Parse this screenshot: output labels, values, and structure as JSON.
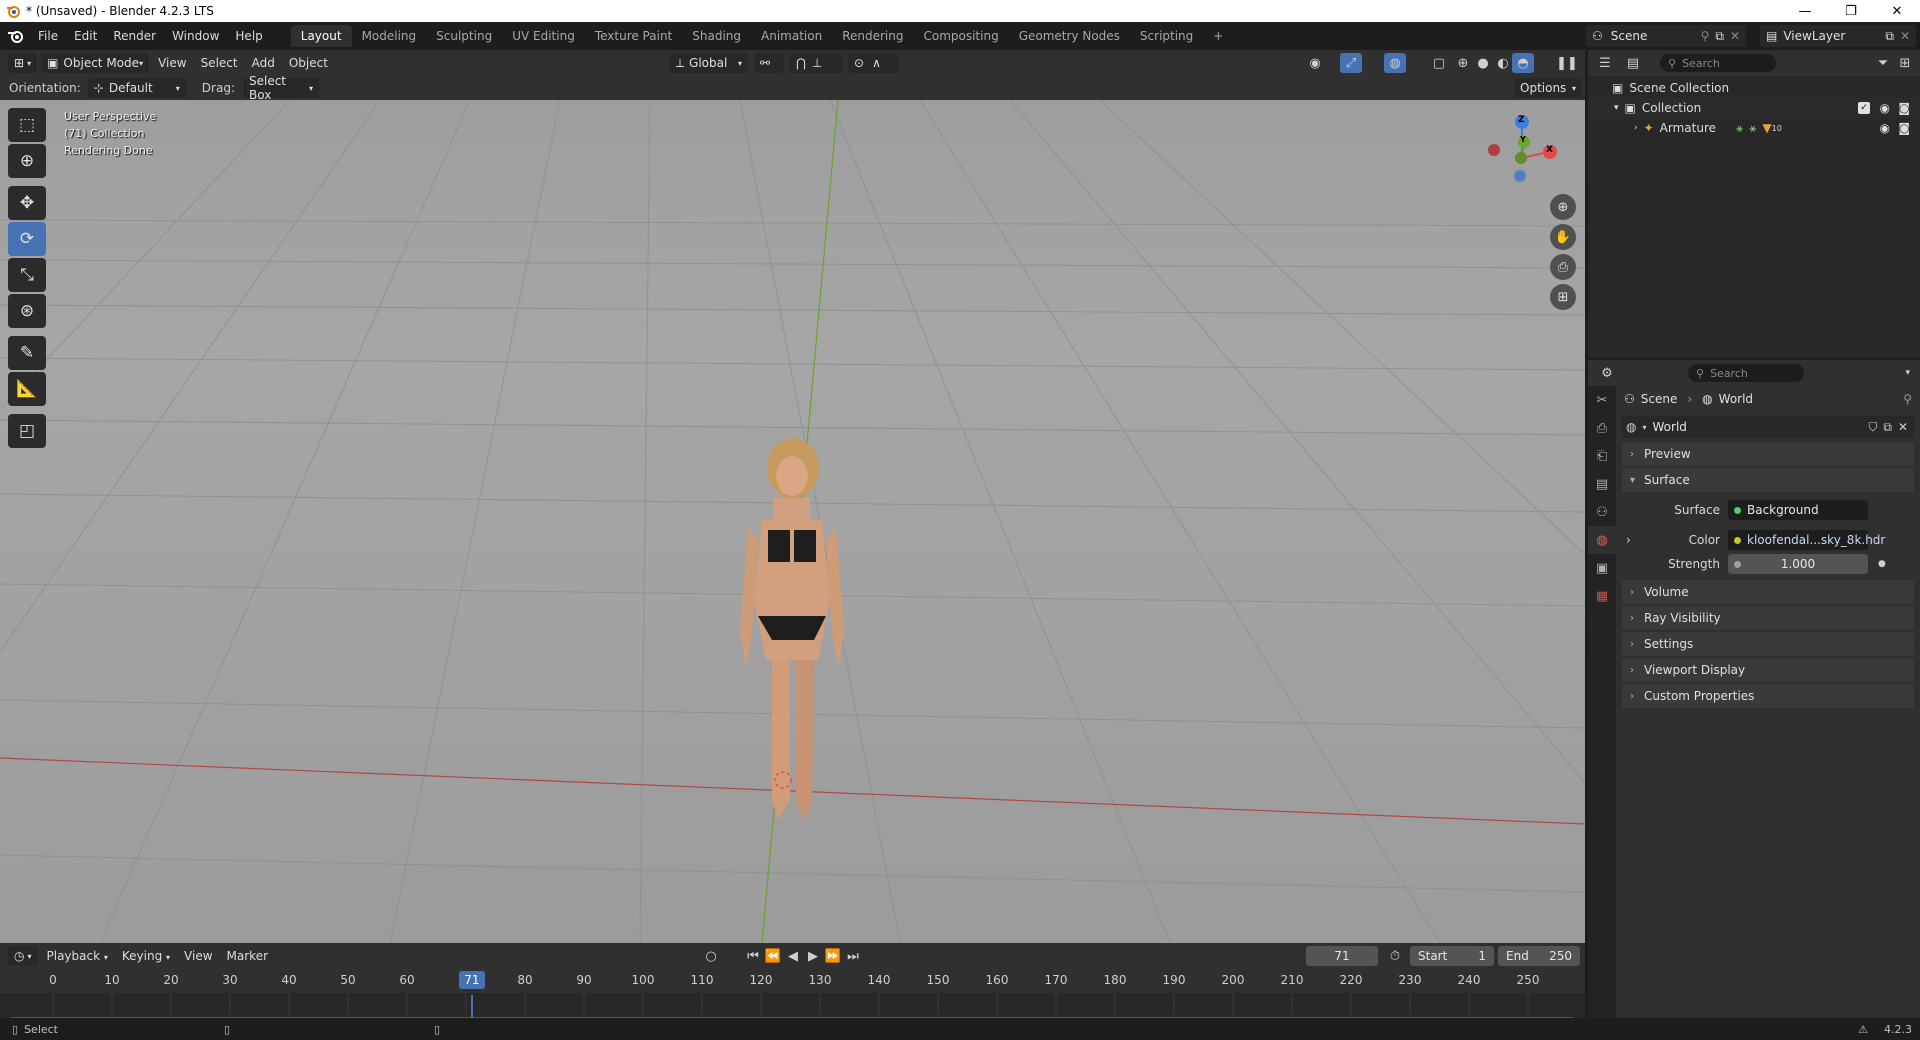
{
  "window": {
    "title": "* (Unsaved) - Blender 4.2.3 LTS",
    "controls": [
      "—",
      "❐",
      "✕"
    ]
  },
  "menu": [
    "File",
    "Edit",
    "Render",
    "Window",
    "Help"
  ],
  "workspaces": [
    "Layout",
    "Modeling",
    "Sculpting",
    "UV Editing",
    "Texture Paint",
    "Shading",
    "Animation",
    "Rendering",
    "Compositing",
    "Geometry Nodes",
    "Scripting"
  ],
  "workspace_add": "+",
  "scene": {
    "name": "Scene",
    "view_layer": "ViewLayer"
  },
  "viewport_header": {
    "mode": "Object Mode",
    "menus": [
      "View",
      "Select",
      "Add",
      "Object"
    ],
    "transform": "Global"
  },
  "tool_settings": {
    "orientation_label": "Orientation:",
    "orientation_value": "Default",
    "drag_label": "Drag:",
    "drag_value": "Select Box",
    "options": "Options"
  },
  "viewport": {
    "perspective": "User Perspective",
    "collection": "(71) Collection",
    "status": "Rendering Done",
    "gizmo_axes": {
      "x": "X",
      "y": "Y",
      "z": "Z"
    }
  },
  "outliner": {
    "search_placeholder": "Search",
    "scene_collection": "Scene Collection",
    "collection": "Collection",
    "armature": "Armature",
    "armature_count": "10"
  },
  "properties": {
    "search_placeholder": "Search",
    "breadcrumb": [
      "Scene",
      "World"
    ],
    "world_name": "World",
    "panels": {
      "preview": "Preview",
      "surface": "Surface",
      "volume": "Volume",
      "ray_visibility": "Ray Visibility",
      "settings": "Settings",
      "viewport_display": "Viewport Display",
      "custom_properties": "Custom Properties"
    },
    "surface_label": "Surface",
    "surface_value": "Background",
    "color_label": "Color",
    "color_value": "kloofendal...sky_8k.hdr",
    "strength_label": "Strength",
    "strength_value": "1.000"
  },
  "timeline": {
    "menus": [
      "Playback",
      "Keying",
      "View",
      "Marker"
    ],
    "current_frame": "71",
    "start_label": "Start",
    "start_value": "1",
    "end_label": "End",
    "end_value": "250",
    "ticks": [
      "0",
      "10",
      "20",
      "30",
      "40",
      "50",
      "60",
      "70",
      "80",
      "90",
      "100",
      "110",
      "120",
      "130",
      "140",
      "150",
      "160",
      "170",
      "180",
      "190",
      "200",
      "210",
      "220",
      "230",
      "240",
      "250"
    ]
  },
  "statusbar": {
    "select": "Select",
    "version": "4.2.3"
  },
  "colors": {
    "accent": "#4772b3",
    "axis_x": "#e04a4a",
    "axis_y": "#6aa82a",
    "axis_z": "#3a7fd8"
  }
}
